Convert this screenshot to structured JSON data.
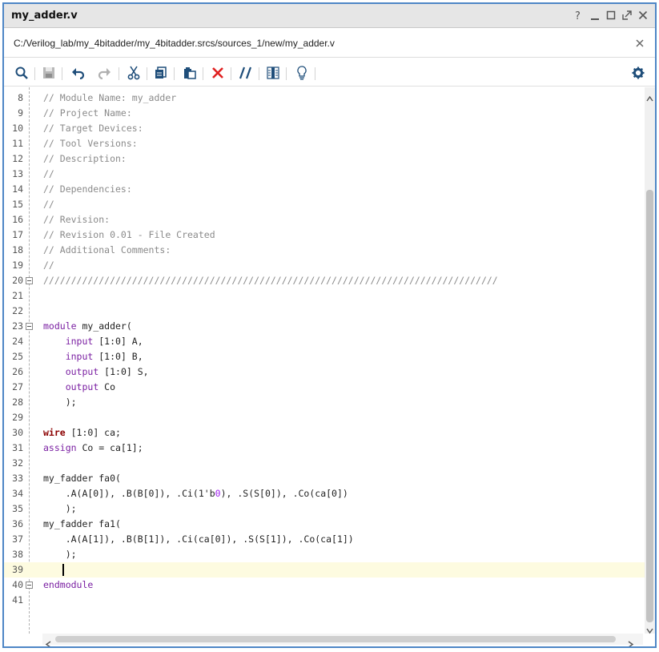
{
  "window": {
    "title": "my_adder.v",
    "controls": [
      "help-icon",
      "minimize-icon",
      "maximize-icon",
      "float-icon",
      "close-icon"
    ]
  },
  "file": {
    "path": "C:/Verilog_lab/my_4bitadder/my_4bitadder.srcs/sources_1/new/my_adder.v"
  },
  "toolbar": {
    "icons": [
      "search-icon",
      "save-icon",
      "undo-icon",
      "redo-icon",
      "cut-icon",
      "copy-icon",
      "paste-icon",
      "delete-icon",
      "comment-toggle-icon",
      "column-select-icon",
      "lightbulb-icon",
      "settings-icon"
    ]
  },
  "editor": {
    "current_line": 39,
    "lines": [
      {
        "n": "8",
        "fold": false,
        "tokens": [
          {
            "t": "// Module Name: my_adder",
            "c": "comment"
          }
        ]
      },
      {
        "n": "9",
        "fold": false,
        "tokens": [
          {
            "t": "// Project Name:",
            "c": "comment"
          }
        ]
      },
      {
        "n": "10",
        "fold": false,
        "tokens": [
          {
            "t": "// Target Devices:",
            "c": "comment"
          }
        ]
      },
      {
        "n": "11",
        "fold": false,
        "tokens": [
          {
            "t": "// Tool Versions:",
            "c": "comment"
          }
        ]
      },
      {
        "n": "12",
        "fold": false,
        "tokens": [
          {
            "t": "// Description:",
            "c": "comment"
          }
        ]
      },
      {
        "n": "13",
        "fold": false,
        "tokens": [
          {
            "t": "//",
            "c": "comment"
          }
        ]
      },
      {
        "n": "14",
        "fold": false,
        "tokens": [
          {
            "t": "// Dependencies:",
            "c": "comment"
          }
        ]
      },
      {
        "n": "15",
        "fold": false,
        "tokens": [
          {
            "t": "//",
            "c": "comment"
          }
        ]
      },
      {
        "n": "16",
        "fold": false,
        "tokens": [
          {
            "t": "// Revision:",
            "c": "comment"
          }
        ]
      },
      {
        "n": "17",
        "fold": false,
        "tokens": [
          {
            "t": "// Revision 0.01 - File Created",
            "c": "comment"
          }
        ]
      },
      {
        "n": "18",
        "fold": false,
        "tokens": [
          {
            "t": "// Additional Comments:",
            "c": "comment"
          }
        ]
      },
      {
        "n": "19",
        "fold": false,
        "tokens": [
          {
            "t": "//",
            "c": "comment"
          }
        ]
      },
      {
        "n": "20",
        "fold": true,
        "tokens": [
          {
            "t": "//////////////////////////////////////////////////////////////////////////////////",
            "c": "comment"
          }
        ]
      },
      {
        "n": "21",
        "fold": false,
        "tokens": []
      },
      {
        "n": "22",
        "fold": false,
        "tokens": []
      },
      {
        "n": "23",
        "fold": true,
        "tokens": [
          {
            "t": "module",
            "c": "kw"
          },
          {
            "t": " my_adder(",
            "c": ""
          }
        ]
      },
      {
        "n": "24",
        "fold": false,
        "tokens": [
          {
            "t": "    ",
            "c": ""
          },
          {
            "t": "input",
            "c": "kw"
          },
          {
            "t": " [1:0] A,",
            "c": ""
          }
        ]
      },
      {
        "n": "25",
        "fold": false,
        "tokens": [
          {
            "t": "    ",
            "c": ""
          },
          {
            "t": "input",
            "c": "kw"
          },
          {
            "t": " [1:0] B,",
            "c": ""
          }
        ]
      },
      {
        "n": "26",
        "fold": false,
        "tokens": [
          {
            "t": "    ",
            "c": ""
          },
          {
            "t": "output",
            "c": "kw"
          },
          {
            "t": " [1:0] S,",
            "c": ""
          }
        ]
      },
      {
        "n": "27",
        "fold": false,
        "tokens": [
          {
            "t": "    ",
            "c": ""
          },
          {
            "t": "output",
            "c": "kw"
          },
          {
            "t": " Co",
            "c": ""
          }
        ]
      },
      {
        "n": "28",
        "fold": false,
        "tokens": [
          {
            "t": "    );",
            "c": ""
          }
        ]
      },
      {
        "n": "29",
        "fold": false,
        "tokens": []
      },
      {
        "n": "30",
        "fold": false,
        "tokens": [
          {
            "t": "wire",
            "c": "type"
          },
          {
            "t": " [1:0] ca;",
            "c": ""
          }
        ]
      },
      {
        "n": "31",
        "fold": false,
        "tokens": [
          {
            "t": "assign",
            "c": "kw"
          },
          {
            "t": " Co = ca[1];",
            "c": ""
          }
        ]
      },
      {
        "n": "32",
        "fold": false,
        "tokens": []
      },
      {
        "n": "33",
        "fold": false,
        "tokens": [
          {
            "t": "my_fadder fa0(",
            "c": ""
          }
        ]
      },
      {
        "n": "34",
        "fold": false,
        "tokens": [
          {
            "t": "    .A(A[0]), .B(B[0]), .Ci(1'b",
            "c": ""
          },
          {
            "t": "0",
            "c": "str"
          },
          {
            "t": "), .S(S[0]), .Co(ca[0])",
            "c": ""
          }
        ]
      },
      {
        "n": "35",
        "fold": false,
        "tokens": [
          {
            "t": "    );",
            "c": ""
          }
        ]
      },
      {
        "n": "36",
        "fold": false,
        "tokens": [
          {
            "t": "my_fadder fa1(",
            "c": ""
          }
        ]
      },
      {
        "n": "37",
        "fold": false,
        "tokens": [
          {
            "t": "    .A(A[1]), .B(B[1]), .Ci(ca[0]), .S(S[1]), .Co(ca[1])",
            "c": ""
          }
        ]
      },
      {
        "n": "38",
        "fold": false,
        "tokens": [
          {
            "t": "    );",
            "c": ""
          }
        ]
      },
      {
        "n": "39",
        "fold": false,
        "tokens": []
      },
      {
        "n": "40",
        "fold": true,
        "tokens": [
          {
            "t": "endmodule",
            "c": "kw"
          }
        ]
      },
      {
        "n": "41",
        "fold": false,
        "tokens": []
      }
    ]
  },
  "colors": {
    "window_border": "#4e86c6",
    "comment": "#8a8a8a",
    "keyword": "#7a1fa2",
    "type_keyword": "#8b0000",
    "current_line_bg": "#fdfbe0",
    "delete_icon": "#e02020",
    "toolbar_icon": "#1f4e7a",
    "marker_green": "#22dd22"
  }
}
